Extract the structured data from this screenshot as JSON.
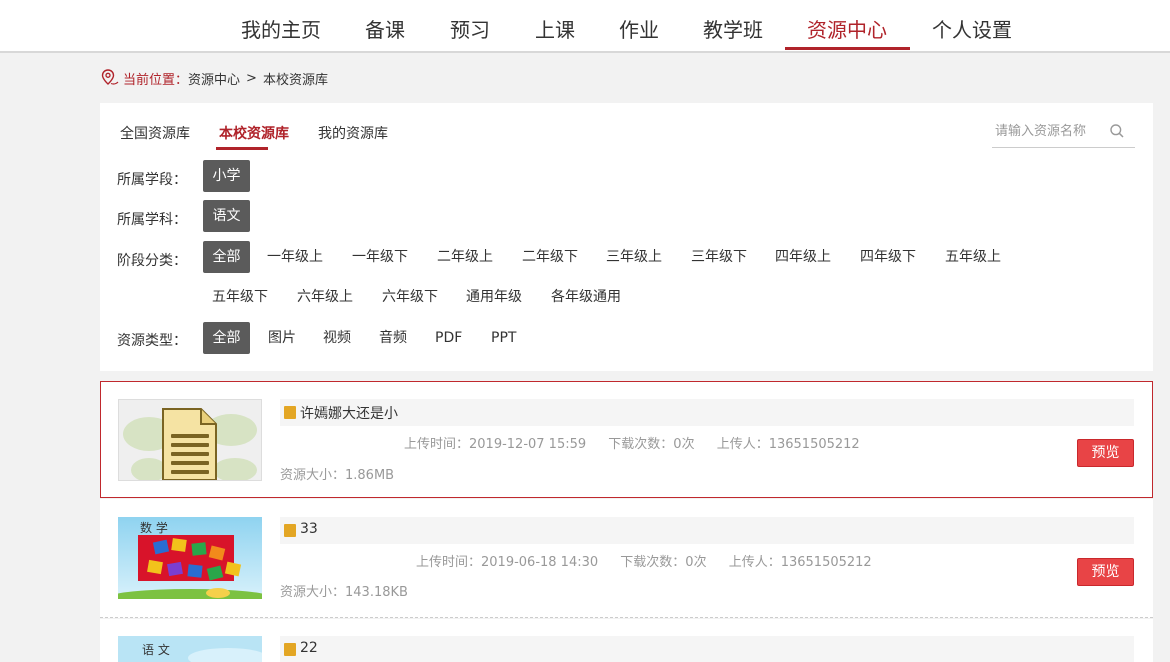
{
  "nav": {
    "items": [
      "我的主页",
      "备课",
      "预习",
      "上课",
      "作业",
      "教学班",
      "资源中心",
      "个人设置"
    ],
    "active_index": 6
  },
  "breadcrumb": {
    "label": "当前位置：",
    "path": [
      "资源中心",
      "本校资源库"
    ],
    "separator": ">"
  },
  "tabs": {
    "items": [
      "全国资源库",
      "本校资源库",
      "我的资源库"
    ],
    "active_index": 1
  },
  "search": {
    "placeholder": "请输入资源名称"
  },
  "filters": {
    "stage": {
      "label": "所属学段：",
      "options": [
        "小学"
      ]
    },
    "subject": {
      "label": "所属学科：",
      "options": [
        "语文"
      ]
    },
    "grade": {
      "label": "阶段分类：",
      "options": [
        "全部",
        "一年级上",
        "一年级下",
        "二年级上",
        "二年级下",
        "三年级上",
        "三年级下",
        "四年级上",
        "四年级下",
        "五年级上",
        "五年级下",
        "六年级上",
        "六年级下",
        "通用年级",
        "各年级通用"
      ]
    },
    "type": {
      "label": "资源类型：",
      "options": [
        "全部",
        "图片",
        "视频",
        "音频",
        "PDF",
        "PPT"
      ]
    }
  },
  "resources": [
    {
      "title": "许嫣娜大还是小",
      "upload_time": "上传时间：2019-12-07 15:59",
      "downloads": "下载次数：0次",
      "uploader": "上传人：13651505212",
      "size": "资源大小：1.86MB",
      "preview_label": "预览",
      "thumb": "document"
    },
    {
      "title": "33",
      "upload_time": "上传时间：2019-06-18 14:30",
      "downloads": "下载次数：0次",
      "uploader": "上传人：13651505212",
      "size": "资源大小：143.18KB",
      "preview_label": "预览",
      "thumb": "math",
      "thumb_caption": "数 学"
    },
    {
      "title": "22",
      "thumb": "chinese",
      "thumb_caption": "语 文"
    }
  ],
  "colors": {
    "accent": "#b0232a",
    "selected_bg": "#5b5b5b",
    "preview_button": "#e84446",
    "file_icon": "#e3a624"
  }
}
